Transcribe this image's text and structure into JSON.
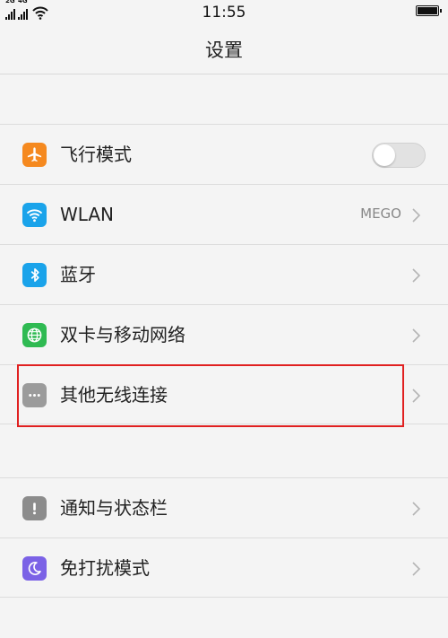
{
  "status_bar": {
    "time": "11:55",
    "sim1_tag": "2G",
    "sim2_tag": "4G",
    "icons": [
      "signal-icon",
      "signal-icon",
      "wifi-icon",
      "battery-icon"
    ]
  },
  "header": {
    "title": "设置"
  },
  "settings": {
    "airplane": {
      "label": "飞行模式",
      "icon": "airplane-icon",
      "icon_color": "#f5891f",
      "toggle_on": false
    },
    "wlan": {
      "label": "WLAN",
      "value": "MEGO",
      "icon": "wifi-icon",
      "icon_color": "#1aa3ea"
    },
    "bluetooth": {
      "label": "蓝牙",
      "icon": "bluetooth-icon",
      "icon_color": "#1aa3ea"
    },
    "mobile_network": {
      "label": "双卡与移动网络",
      "icon": "globe-icon",
      "icon_color": "#2fba52"
    },
    "other_wireless": {
      "label": "其他无线连接",
      "icon": "more-icon",
      "icon_color": "#9b9b9b"
    },
    "notifications": {
      "label": "通知与状态栏",
      "icon": "exclamation-icon",
      "icon_color": "#8c8c8c"
    },
    "do_not_disturb": {
      "label": "免打扰模式",
      "icon": "moon-icon",
      "icon_color": "#7b62e6"
    }
  },
  "colors": {
    "highlight_border": "#e02020",
    "background": "#f4f4f4",
    "chevron": "#b5b5b5"
  }
}
